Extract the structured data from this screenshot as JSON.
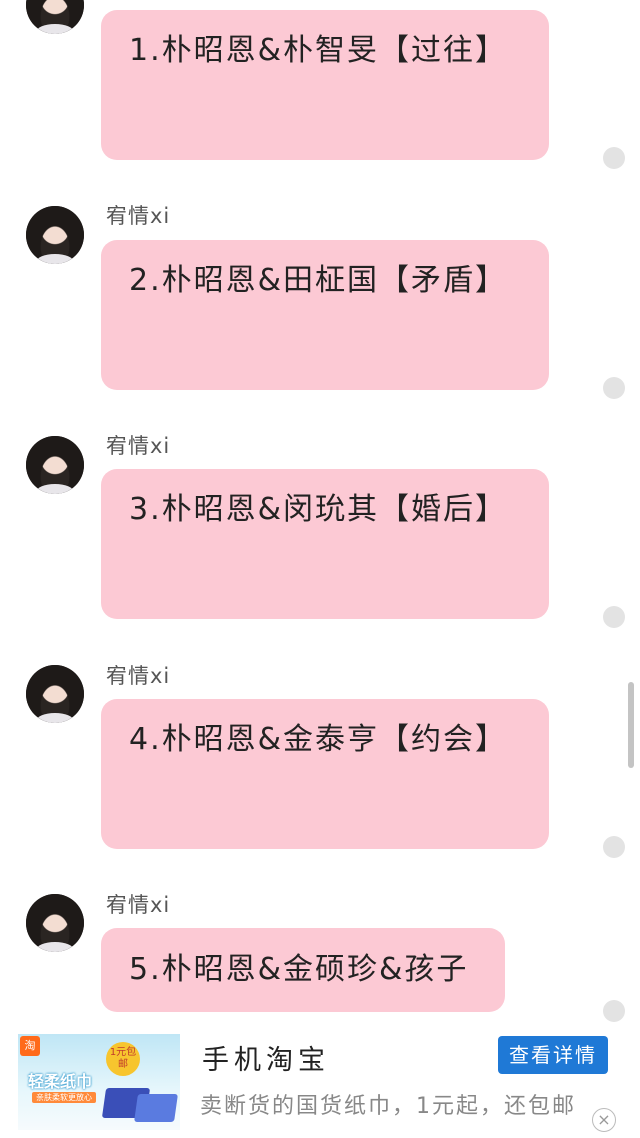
{
  "messages": [
    {
      "sender": "",
      "text": "1.朴昭恩&朴智旻【过往】"
    },
    {
      "sender": "宥情xi",
      "text": "2.朴昭恩&田柾国【矛盾】"
    },
    {
      "sender": "宥情xi",
      "text": "3.朴昭恩&闵玧其【婚后】"
    },
    {
      "sender": "宥情xi",
      "text": "4.朴昭恩&金泰亨【约会】"
    },
    {
      "sender": "宥情xi",
      "text": "5.朴昭恩&金硕珍&孩子"
    }
  ],
  "ad": {
    "thumb_logo": "淘",
    "thumb_badge": "1元包邮",
    "thumb_title": "轻柔纸巾",
    "thumb_sub": "亲肤柔软更放心",
    "title": "手机淘宝",
    "button": "查看详情",
    "description": "卖断货的国货纸巾，1元起，还包邮",
    "close_glyph": "×"
  },
  "colors": {
    "bubble": "#fcc9d4",
    "ad_button": "#1f79d6"
  }
}
